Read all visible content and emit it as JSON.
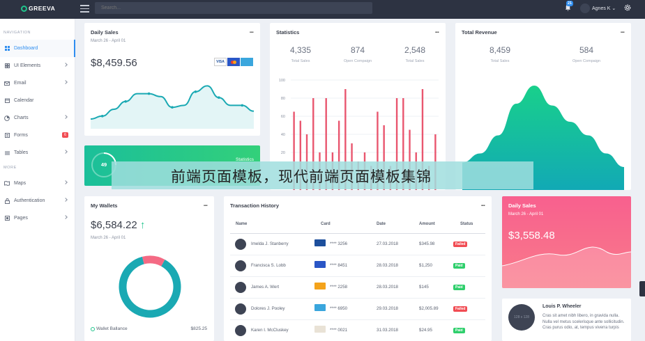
{
  "app": {
    "logo": "GREEVA",
    "search_placeholder": "Search...",
    "notifications_count": "21",
    "user_name": "Agnes K"
  },
  "sidebar": {
    "heading_navigation": "NAVIGATION",
    "heading_more": "MORE",
    "items": [
      {
        "label": "Dashboard"
      },
      {
        "label": "UI Elements"
      },
      {
        "label": "Email"
      },
      {
        "label": "Calendar"
      },
      {
        "label": "Charts"
      },
      {
        "label": "Forms",
        "badge": "6"
      },
      {
        "label": "Tables"
      },
      {
        "label": "Maps"
      },
      {
        "label": "Authentication"
      },
      {
        "label": "Pages"
      }
    ]
  },
  "daily_sales": {
    "title": "Daily Sales",
    "range": "March 26 - April 01",
    "value": "$8,459.56",
    "menu": "..."
  },
  "statistics": {
    "title": "Statistics",
    "menu": "...",
    "stats": [
      {
        "value": "4,335",
        "label": "Total Sales"
      },
      {
        "value": "874",
        "label": "Open Compaign"
      },
      {
        "value": "2,548",
        "label": "Total Sales"
      }
    ]
  },
  "total_revenue": {
    "title": "Total Revenue",
    "menu": "...",
    "stats": [
      {
        "value": "8,459",
        "label": "Total Sales"
      },
      {
        "value": "584",
        "label": "Open Compaign"
      }
    ]
  },
  "green_card": {
    "value": "49",
    "label": "Statistics"
  },
  "my_wallets": {
    "title": "My Wallets",
    "menu": "...",
    "value": "$6,584.22",
    "range": "March 26 - April 01",
    "legend_label": "Wallet Ballance",
    "legend_value": "$825.25"
  },
  "transactions": {
    "title": "Transaction History",
    "menu": "...",
    "columns": [
      "Name",
      "Card",
      "Date",
      "Amount",
      "Status"
    ],
    "rows": [
      {
        "name": "Imelda J. Stanberry",
        "card": "**** 3256",
        "date": "27.03.2018",
        "amount": "$345.98",
        "status": "Failed",
        "card_color": "#1d4f9c"
      },
      {
        "name": "Francisca S. Lobb",
        "card": "**** 8451",
        "date": "28.03.2018",
        "amount": "$1,250",
        "status": "Paid",
        "card_color": "#2a56c6"
      },
      {
        "name": "James A. Wert",
        "card": "**** 2258",
        "date": "28.03.2018",
        "amount": "$145",
        "status": "Paid",
        "card_color": "#f4a31b"
      },
      {
        "name": "Dolores J. Pooley",
        "card": "**** 6950",
        "date": "29.03.2018",
        "amount": "$2,005.89",
        "status": "Failed",
        "card_color": "#3aa6dd"
      },
      {
        "name": "Karen I. McCluskey",
        "card": "**** 0021",
        "date": "31.03.2018",
        "amount": "$24.95",
        "status": "Paid",
        "card_color": "#e9e2d6"
      }
    ]
  },
  "pink_card": {
    "title": "Daily Sales",
    "range": "March 26 - April 01",
    "value": "$3,558.48"
  },
  "profile": {
    "avatar_text": "128 x 128",
    "name": "Louis P. Wheeler",
    "text": "Cras sit amet nibh libero, in gravida nulla. Nulla vel metus scelerisque ante sollicitudin. Cras purus odio, at, tempus viverra turpis"
  },
  "overlay_text": "前端页面模板，现代前端页面模板集锦",
  "chart_data": [
    {
      "type": "area",
      "title": "Daily Sales",
      "values": [
        10,
        13,
        20,
        28,
        36,
        36,
        33,
        22,
        24,
        38,
        44,
        32,
        24,
        24,
        18
      ]
    },
    {
      "type": "bar",
      "title": "Statistics",
      "ylim": [
        0,
        100
      ],
      "yticks": [
        20,
        40,
        60,
        80,
        100
      ],
      "values": [
        65,
        55,
        40,
        80,
        20,
        80,
        20,
        55,
        90,
        30,
        10,
        20,
        5,
        65,
        50,
        5,
        80,
        80,
        45,
        20,
        90,
        5,
        40
      ]
    },
    {
      "type": "area",
      "title": "Total Revenue",
      "values": [
        15,
        25,
        45,
        80,
        100,
        78,
        60,
        45,
        25,
        10
      ]
    },
    {
      "type": "pie",
      "title": "My Wallets",
      "values": [
        88,
        12
      ],
      "colors": [
        "#1aa9b3",
        "#f46a84"
      ]
    }
  ],
  "colors": {
    "primary": "#2f8ef0",
    "teal": "#1aa9b3",
    "green": "#21c48c",
    "pink": "#f46a84",
    "bar": "#e9566f",
    "failed": "#f14c53",
    "paid": "#2fcf6c"
  }
}
